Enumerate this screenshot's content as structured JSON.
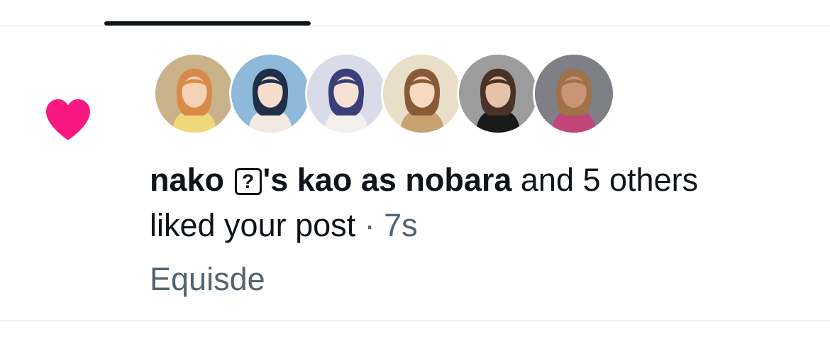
{
  "colors": {
    "heart": "#f91880",
    "indicator": "#0f1419",
    "text": "#0f1419",
    "muted": "#536471",
    "divider": "#e3e6e8"
  },
  "notification": {
    "icon": "heart-icon",
    "avatars": [
      {
        "name": "avatar-1",
        "bg": "#c9b28a",
        "hair": "#d98a4a",
        "skin": "#f3d2b5",
        "cloth": "#f0d77a"
      },
      {
        "name": "avatar-2",
        "bg": "#8fb9d8",
        "hair": "#1f2f4a",
        "skin": "#f6dccb",
        "cloth": "#f3e9e1"
      },
      {
        "name": "avatar-3",
        "bg": "#d9dbe8",
        "hair": "#3a3f7a",
        "skin": "#f7e1d6",
        "cloth": "#f2efee"
      },
      {
        "name": "avatar-4",
        "bg": "#e9dfc9",
        "hair": "#8a5a36",
        "skin": "#f6d9bf",
        "cloth": "#c7a26e"
      },
      {
        "name": "avatar-5",
        "bg": "#9c9c9c",
        "hair": "#4a3326",
        "skin": "#e8c2a8",
        "cloth": "#1a1a1a"
      },
      {
        "name": "avatar-6",
        "bg": "#7f7f86",
        "hair": "#a0724a",
        "skin": "#c99574",
        "cloth": "#c2457a"
      }
    ],
    "user_name": "nako",
    "emoji_placeholder": "?",
    "name_suffix": "'s kao as nobara",
    "others": " and 5 others",
    "action": "liked your post",
    "separator": " · ",
    "time": "7s",
    "post_excerpt": "Equisde"
  }
}
